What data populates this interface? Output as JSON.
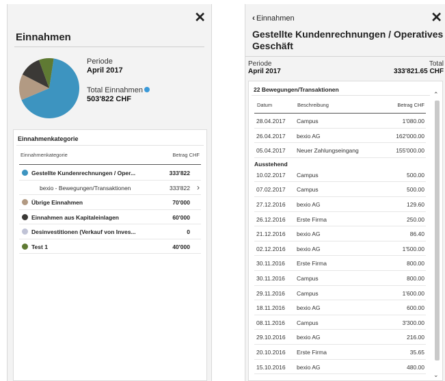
{
  "left": {
    "title": "Einnahmen",
    "close": "✕",
    "periode_label": "Periode",
    "periode_value": "April 2017",
    "total_label": "Total Einnahmen",
    "total_value": "503'822 CHF",
    "card_title": "Einnahmenkategorie",
    "col_category": "Einnahmenkategorie",
    "col_amount": "Betrag CHF",
    "pie": [
      {
        "value": 333822,
        "color": "#3d94c0"
      },
      {
        "value": 70000,
        "color": "#b29a83"
      },
      {
        "value": 60000,
        "color": "#3b3936"
      },
      {
        "value": 40000,
        "color": "#5f7a33"
      }
    ],
    "categories": [
      {
        "name": "Gestellte Kundenrechnungen / Oper...",
        "amount": "333'822",
        "color": "#3d94c0"
      },
      {
        "name": "bexio - Bewegungen/Transaktionen",
        "amount": "333'822",
        "sub": true
      },
      {
        "name": "Übrige Einnahmen",
        "amount": "70'000",
        "color": "#b29a83"
      },
      {
        "name": "Einnahmen aus Kapitaleinlagen",
        "amount": "60'000",
        "color": "#3b3936"
      },
      {
        "name": "Desinvestitionen (Verkauf von Inves...",
        "amount": "0",
        "color": "#c0c3d6"
      },
      {
        "name": "Test 1",
        "amount": "40'000",
        "color": "#5f7a33"
      }
    ]
  },
  "right": {
    "back_label": "Einnahmen",
    "close": "✕",
    "title": "Gestellte Kundenrechnungen / Operatives Geschäft",
    "periode_label": "Periode",
    "periode_value": "April 2017",
    "total_label": "Total",
    "total_value": "333'821.65 CHF",
    "card_title": "22 Bewegungen/Transaktionen",
    "col_date": "Datum",
    "col_desc": "Beschreibung",
    "col_amount": "Betrag CHF",
    "booked": [
      {
        "date": "28.04.2017",
        "desc": "Campus",
        "amount": "1'080.00"
      },
      {
        "date": "26.04.2017",
        "desc": "bexio AG",
        "amount": "162'000.00"
      },
      {
        "date": "05.04.2017",
        "desc": "Neuer Zahlungseingang",
        "amount": "155'000.00"
      }
    ],
    "pending_label": "Ausstehend",
    "pending": [
      {
        "date": "10.02.2017",
        "desc": "Campus",
        "amount": "500.00"
      },
      {
        "date": "07.02.2017",
        "desc": "Campus",
        "amount": "500.00"
      },
      {
        "date": "27.12.2016",
        "desc": "bexio AG",
        "amount": "129.60"
      },
      {
        "date": "26.12.2016",
        "desc": "Erste Firma",
        "amount": "250.00"
      },
      {
        "date": "21.12.2016",
        "desc": "bexio AG",
        "amount": "86.40"
      },
      {
        "date": "02.12.2016",
        "desc": "bexio AG",
        "amount": "1'500.00"
      },
      {
        "date": "30.11.2016",
        "desc": "Erste Firma",
        "amount": "800.00"
      },
      {
        "date": "30.11.2016",
        "desc": "Campus",
        "amount": "800.00"
      },
      {
        "date": "29.11.2016",
        "desc": "Campus",
        "amount": "1'600.00"
      },
      {
        "date": "18.11.2016",
        "desc": "bexio AG",
        "amount": "600.00"
      },
      {
        "date": "08.11.2016",
        "desc": "Campus",
        "amount": "3'300.00"
      },
      {
        "date": "29.10.2016",
        "desc": "bexio AG",
        "amount": "216.00"
      },
      {
        "date": "20.10.2016",
        "desc": "Erste Firma",
        "amount": "35.65"
      },
      {
        "date": "15.10.2016",
        "desc": "bexio AG",
        "amount": "480.00"
      }
    ]
  }
}
